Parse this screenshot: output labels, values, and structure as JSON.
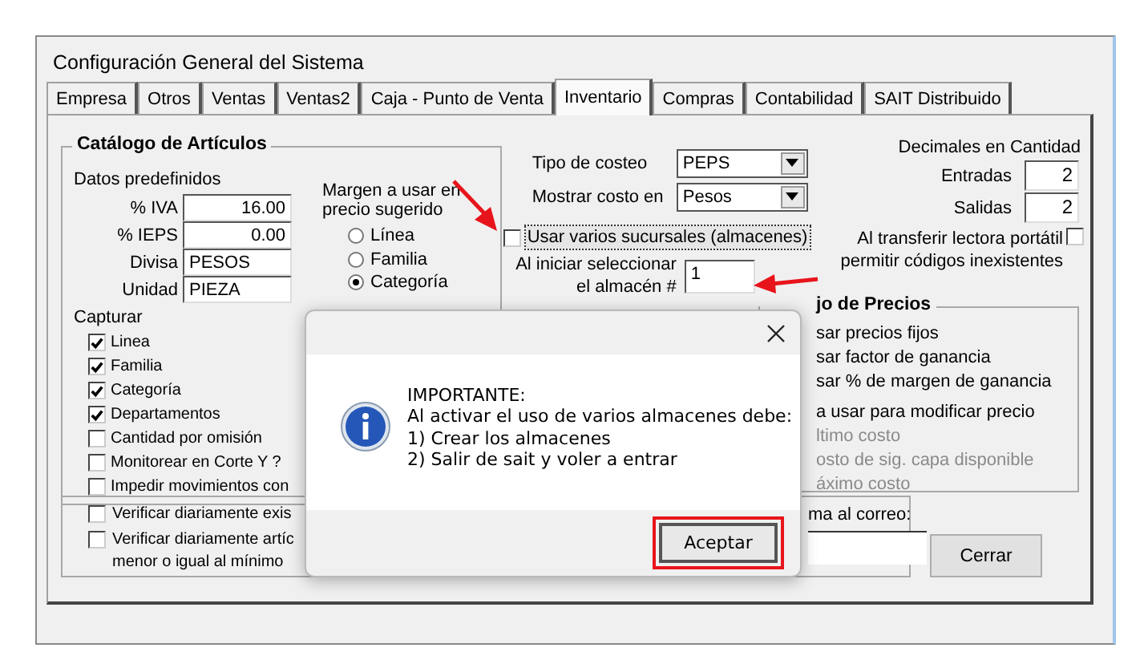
{
  "window": {
    "title": "Configuración General del Sistema"
  },
  "tabs": [
    {
      "label": "Empresa",
      "selected": false
    },
    {
      "label": "Otros",
      "selected": false
    },
    {
      "label": "Ventas",
      "selected": false
    },
    {
      "label": "Ventas2",
      "selected": false
    },
    {
      "label": "Caja - Punto de Venta",
      "selected": false
    },
    {
      "label": "Inventario",
      "selected": true
    },
    {
      "label": "Compras",
      "selected": false
    },
    {
      "label": "Contabilidad",
      "selected": false
    },
    {
      "label": "SAIT Distribuido",
      "selected": false
    }
  ],
  "catalog": {
    "title": "Catálogo de Artículos",
    "defaults_label": "Datos predefinidos",
    "fields": [
      {
        "label": "% IVA",
        "value": "16.00",
        "kind": "number"
      },
      {
        "label": "% IEPS",
        "value": "0.00",
        "kind": "number"
      },
      {
        "label": "Divisa",
        "value": "PESOS",
        "kind": "text"
      },
      {
        "label": "Unidad",
        "value": "PIEZA",
        "kind": "text"
      }
    ],
    "margin_label": "Margen a usar en precio sugerido",
    "margin_options": [
      {
        "label": "Línea",
        "selected": false
      },
      {
        "label": "Familia",
        "selected": false
      },
      {
        "label": "Categoría",
        "selected": true
      }
    ],
    "capture_label": "Capturar",
    "capture": [
      {
        "label": "Linea",
        "checked": true
      },
      {
        "label": "Familia",
        "checked": true
      },
      {
        "label": "Categoría",
        "checked": true
      },
      {
        "label": "Departamentos",
        "checked": true
      },
      {
        "label": "Cantidad por omisión",
        "checked": false
      },
      {
        "label": "Monitorear en Corte Y ?",
        "checked": false
      },
      {
        "label": "Impedir movimientos con",
        "checked": false
      }
    ]
  },
  "verify": [
    {
      "lines": [
        "Verificar diariamente exis"
      ],
      "checked": false
    },
    {
      "lines": [
        "Verificar diariamente artíc",
        "menor o igual al mínimo"
      ],
      "checked": false
    }
  ],
  "costing": [
    {
      "label": "Tipo de costeo",
      "value": "PEPS"
    },
    {
      "label": "Mostrar costo en",
      "value": "Pesos"
    }
  ],
  "multi_store": {
    "label": "Usar varios sucursales (almacenes)",
    "checked": false,
    "focused": true
  },
  "start_store": {
    "lines": [
      "Al iniciar seleccionar",
      "el almacén #"
    ],
    "value": "1"
  },
  "decimals": {
    "title": "Decimales en Cantidad",
    "fields": [
      {
        "label": "Entradas",
        "value": "2"
      },
      {
        "label": "Salidas",
        "value": "2"
      }
    ]
  },
  "portable": {
    "lines": [
      "Al transferir lectora portátil",
      "permitir códigos inexistentes"
    ],
    "checked": false
  },
  "prices": {
    "title": "jo de Precios",
    "modes": [
      {
        "label": "sar precios fijos"
      },
      {
        "label": "sar factor de ganancia"
      },
      {
        "label": "sar % de margen de ganancia"
      }
    ],
    "modify_label": "a usar para modificar precio",
    "costs": [
      {
        "label": "ltimo costo",
        "disabled": true
      },
      {
        "label": "osto de sig. capa disponible",
        "disabled": true
      },
      {
        "label": "áximo costo",
        "disabled": true
      }
    ]
  },
  "email": {
    "label": "ma al correo:"
  },
  "close_button": "Cerrar",
  "dialog": {
    "lines": [
      "IMPORTANTE:",
      "Al activar el uso de varios almacenes debe:",
      "1) Crear los almacenes",
      "2) Salir de sait y voler a entrar"
    ],
    "button": "Aceptar",
    "button_highlighted": true
  }
}
